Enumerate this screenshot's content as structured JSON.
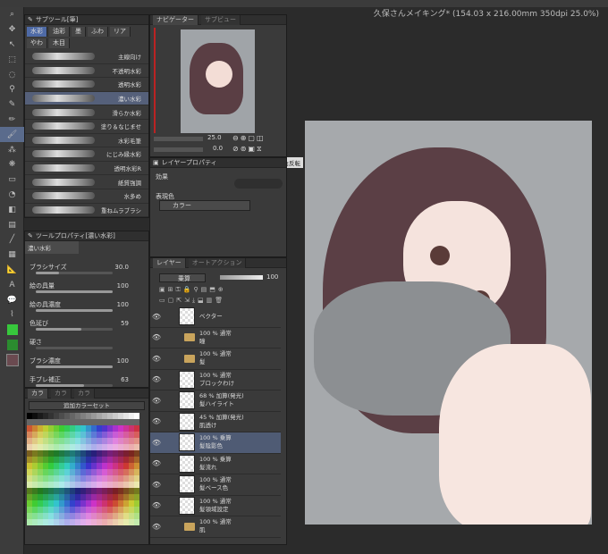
{
  "document_title": "久保さんメイキング* (154.03 x 216.00mm 350dpi 25.0%)",
  "sub_tool": {
    "header": "サブツール[筆]",
    "categories": [
      "水彩",
      "油彩",
      "墨",
      "ふわ",
      "リア",
      "やわ",
      "木目"
    ],
    "brushes": [
      {
        "label": "主線向け"
      },
      {
        "label": "不透明水彩"
      },
      {
        "label": "透明水彩"
      },
      {
        "label": "濃い水彩",
        "selected": true
      },
      {
        "label": "滑らか水彩"
      },
      {
        "label": "塗り＆なじませ"
      },
      {
        "label": "水彩毛筆"
      },
      {
        "label": "にじみ縁水彩"
      },
      {
        "label": "透明水彩R"
      },
      {
        "label": "紙質強調"
      },
      {
        "label": "水多め"
      },
      {
        "label": "重ねムラブラシ"
      }
    ]
  },
  "tool_property": {
    "header": "ツールプロパティ[濃い水彩]",
    "preset": "濃い水彩",
    "rows": [
      {
        "label": "ブラシサイズ",
        "value": "30.0",
        "pct": 30
      },
      {
        "label": "絵の具量",
        "value": "100",
        "pct": 100
      },
      {
        "label": "絵の具濃度",
        "value": "100",
        "pct": 100
      },
      {
        "label": "色延び",
        "value": "59",
        "pct": 59
      },
      {
        "label": "硬さ",
        "value": "",
        "pct": 0
      },
      {
        "label": "ブラシ濃度",
        "value": "100",
        "pct": 100
      },
      {
        "label": "手ブレ補正",
        "value": "63",
        "pct": 63
      }
    ]
  },
  "color_set": {
    "tabs": [
      "カラ",
      "カラ",
      "カラ"
    ],
    "preset": "追加カラーセット"
  },
  "navigator": {
    "tabs": [
      "ナビゲーター",
      "サブビュー"
    ],
    "zoom": "25.0",
    "rotation": "0.0",
    "tooltip": "左右反転"
  },
  "layer_property": {
    "header": "レイヤープロパティ",
    "effect_label": "効果",
    "display_color_label": "表現色",
    "display_color_value": "カラー"
  },
  "layers": {
    "tabs": [
      "レイヤー",
      "オートアクション"
    ],
    "blend_mode": "乗算",
    "opacity": "100",
    "items": [
      {
        "line1": "",
        "line2": "ベクター",
        "folder": false
      },
      {
        "line1": "100 % 通常",
        "line2": "瞳",
        "folder": true
      },
      {
        "line1": "100 % 通常",
        "line2": "髪",
        "folder": true
      },
      {
        "line1": "100 % 通常",
        "line2": "ブロックわけ",
        "folder": false
      },
      {
        "line1": "68 % 加算(発光)",
        "line2": "髪ハイライト",
        "folder": false
      },
      {
        "line1": "45 % 加算(発光)",
        "line2": "肌透け",
        "folder": false
      },
      {
        "line1": "100 % 乗算",
        "line2": "髪陰影色",
        "folder": false,
        "selected": true
      },
      {
        "line1": "100 % 乗算",
        "line2": "髪流れ",
        "folder": false
      },
      {
        "line1": "100 % 通常",
        "line2": "髪ベース色",
        "folder": false
      },
      {
        "line1": "100 % 通常",
        "line2": "髪領域設定",
        "folder": false
      },
      {
        "line1": "100 % 通常",
        "line2": "肌",
        "folder": true
      }
    ]
  }
}
